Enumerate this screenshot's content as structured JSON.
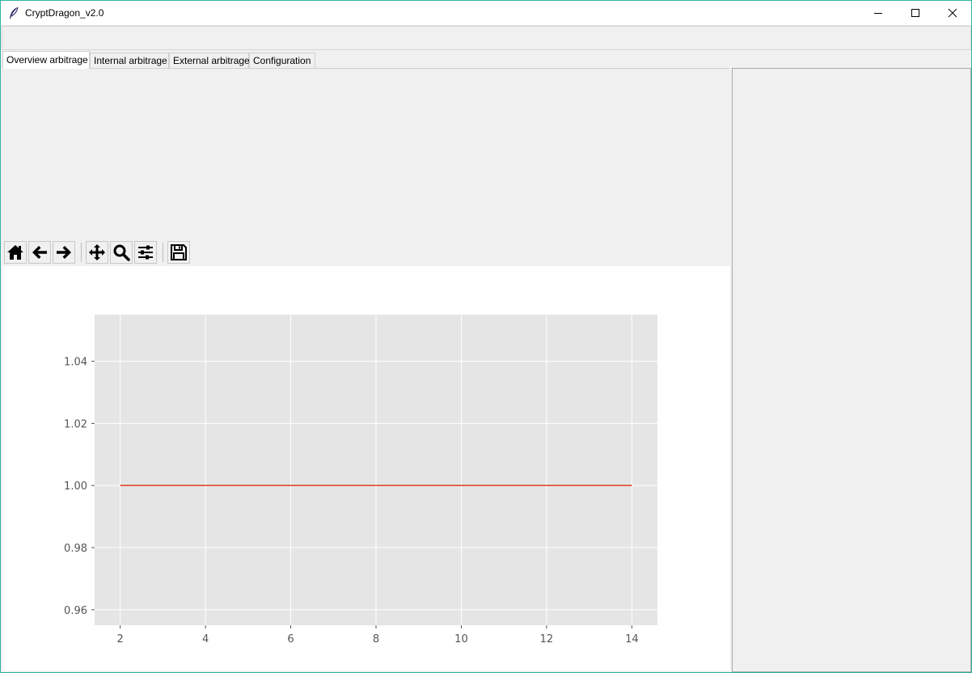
{
  "window": {
    "title": "CryptDragon_v2.0",
    "accent_border": "#2fb3a0",
    "controls": [
      "minimize",
      "maximize",
      "close"
    ]
  },
  "tabs": [
    {
      "label": "Overview arbitrage",
      "active": true
    },
    {
      "label": "Internal arbitrage",
      "active": false
    },
    {
      "label": "External arbitrage",
      "active": false
    },
    {
      "label": "Configuration",
      "active": false
    }
  ],
  "toolbar": {
    "buttons": [
      "home-icon",
      "back-arrow-icon",
      "forward-arrow-icon",
      "pan-icon",
      "zoom-icon",
      "configure-subplots-icon",
      "save-icon"
    ]
  },
  "chart_data": {
    "type": "line",
    "series": [
      {
        "x": [
          2,
          14
        ],
        "y": [
          1.0,
          1.0
        ],
        "color": "#e24a33"
      }
    ],
    "xlim": [
      1.4,
      14.6
    ],
    "ylim": [
      0.955,
      1.055
    ],
    "xticks": [
      "2",
      "4",
      "6",
      "8",
      "10",
      "12",
      "14"
    ],
    "yticks": [
      "0.96",
      "0.98",
      "1.00",
      "1.02",
      "1.04"
    ],
    "title": "",
    "xlabel": "",
    "ylabel": "",
    "grid": true,
    "style": {
      "axes_bg": "#e5e5e5",
      "grid_color": "#ffffff",
      "tick_color": "#555555"
    }
  }
}
